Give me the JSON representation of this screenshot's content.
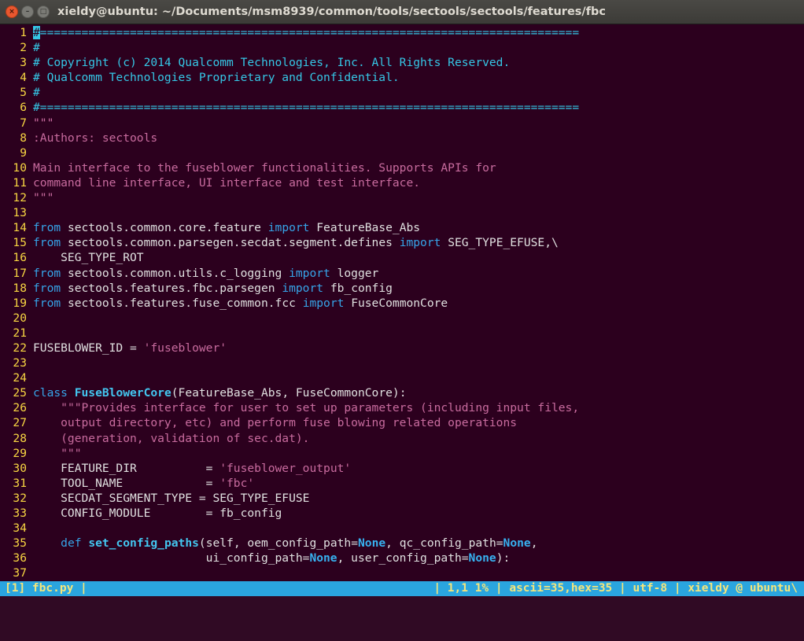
{
  "window": {
    "title": "xieldy@ubuntu: ~/Documents/msm8939/common/tools/sectools/sectools/features/fbc",
    "buttons": {
      "close": "×",
      "minimize": "–",
      "maximize": "□"
    }
  },
  "editor": {
    "lines": [
      {
        "n": "1",
        "segs": [
          {
            "t": "#",
            "c": "cur-block"
          },
          {
            "t": "==============================================================================",
            "c": "cm"
          }
        ]
      },
      {
        "n": "2",
        "segs": [
          {
            "t": "#",
            "c": "cm"
          }
        ]
      },
      {
        "n": "3",
        "segs": [
          {
            "t": "# Copyright (c) 2014 Qualcomm Technologies, Inc. All Rights Reserved.",
            "c": "cm"
          }
        ]
      },
      {
        "n": "4",
        "segs": [
          {
            "t": "# Qualcomm Technologies Proprietary and Confidential.",
            "c": "cm"
          }
        ]
      },
      {
        "n": "5",
        "segs": [
          {
            "t": "#",
            "c": "cm"
          }
        ]
      },
      {
        "n": "6",
        "segs": [
          {
            "t": "#==============================================================================",
            "c": "cm"
          }
        ]
      },
      {
        "n": "7",
        "segs": [
          {
            "t": "\"\"\"",
            "c": "str"
          }
        ]
      },
      {
        "n": "8",
        "segs": [
          {
            "t": ":Authors: sectools",
            "c": "str"
          }
        ]
      },
      {
        "n": "9",
        "segs": []
      },
      {
        "n": "10",
        "segs": [
          {
            "t": "Main interface to the fuseblower functionalities. Supports APIs for",
            "c": "str"
          }
        ]
      },
      {
        "n": "11",
        "segs": [
          {
            "t": "command line interface, UI interface and test interface.",
            "c": "str"
          }
        ]
      },
      {
        "n": "12",
        "segs": [
          {
            "t": "\"\"\"",
            "c": "str"
          }
        ]
      },
      {
        "n": "13",
        "segs": []
      },
      {
        "n": "14",
        "segs": [
          {
            "t": "from",
            "c": "kw"
          },
          {
            "t": " sectools.common.core.feature ",
            "c": ""
          },
          {
            "t": "import",
            "c": "kw"
          },
          {
            "t": " FeatureBase_Abs",
            "c": ""
          }
        ]
      },
      {
        "n": "15",
        "segs": [
          {
            "t": "from",
            "c": "kw"
          },
          {
            "t": " sectools.common.parsegen.secdat.segment.defines ",
            "c": ""
          },
          {
            "t": "import",
            "c": "kw"
          },
          {
            "t": " SEG_TYPE_EFUSE,\\",
            "c": ""
          }
        ]
      },
      {
        "n": "16",
        "segs": [
          {
            "t": "    SEG_TYPE_ROT",
            "c": ""
          }
        ]
      },
      {
        "n": "17",
        "segs": [
          {
            "t": "from",
            "c": "kw"
          },
          {
            "t": " sectools.common.utils.c_logging ",
            "c": ""
          },
          {
            "t": "import",
            "c": "kw"
          },
          {
            "t": " logger",
            "c": ""
          }
        ]
      },
      {
        "n": "18",
        "segs": [
          {
            "t": "from",
            "c": "kw"
          },
          {
            "t": " sectools.features.fbc.parsegen ",
            "c": ""
          },
          {
            "t": "import",
            "c": "kw"
          },
          {
            "t": " fb_config",
            "c": ""
          }
        ]
      },
      {
        "n": "19",
        "segs": [
          {
            "t": "from",
            "c": "kw"
          },
          {
            "t": " sectools.features.fuse_common.fcc ",
            "c": ""
          },
          {
            "t": "import",
            "c": "kw"
          },
          {
            "t": " FuseCommonCore",
            "c": ""
          }
        ]
      },
      {
        "n": "20",
        "segs": []
      },
      {
        "n": "21",
        "segs": []
      },
      {
        "n": "22",
        "segs": [
          {
            "t": "FUSEBLOWER_ID = ",
            "c": ""
          },
          {
            "t": "'fuseblower'",
            "c": "str"
          }
        ]
      },
      {
        "n": "23",
        "segs": []
      },
      {
        "n": "24",
        "segs": []
      },
      {
        "n": "25",
        "segs": [
          {
            "t": "class",
            "c": "kw"
          },
          {
            "t": " ",
            "c": ""
          },
          {
            "t": "FuseBlowerCore",
            "c": "cls"
          },
          {
            "t": "(FeatureBase_Abs, FuseCommonCore):",
            "c": ""
          }
        ]
      },
      {
        "n": "26",
        "segs": [
          {
            "t": "    ",
            "c": ""
          },
          {
            "t": "\"\"\"Provides interface for user to set up parameters (including input files,",
            "c": "str"
          }
        ]
      },
      {
        "n": "27",
        "segs": [
          {
            "t": "    output directory, etc) and perform fuse blowing related operations",
            "c": "str"
          }
        ]
      },
      {
        "n": "28",
        "segs": [
          {
            "t": "    (generation, validation of sec.dat).",
            "c": "str"
          }
        ]
      },
      {
        "n": "29",
        "segs": [
          {
            "t": "    \"\"\"",
            "c": "str"
          }
        ]
      },
      {
        "n": "30",
        "segs": [
          {
            "t": "    FEATURE_DIR          = ",
            "c": ""
          },
          {
            "t": "'fuseblower_output'",
            "c": "str"
          }
        ]
      },
      {
        "n": "31",
        "segs": [
          {
            "t": "    TOOL_NAME            = ",
            "c": ""
          },
          {
            "t": "'fbc'",
            "c": "str"
          }
        ]
      },
      {
        "n": "32",
        "segs": [
          {
            "t": "    SECDAT_SEGMENT_TYPE = SEG_TYPE_EFUSE",
            "c": ""
          }
        ]
      },
      {
        "n": "33",
        "segs": [
          {
            "t": "    CONFIG_MODULE        = fb_config",
            "c": ""
          }
        ]
      },
      {
        "n": "34",
        "segs": []
      },
      {
        "n": "35",
        "segs": [
          {
            "t": "    ",
            "c": ""
          },
          {
            "t": "def",
            "c": "kw"
          },
          {
            "t": " ",
            "c": ""
          },
          {
            "t": "set_config_paths",
            "c": "fn"
          },
          {
            "t": "(self, oem_config_path=",
            "c": ""
          },
          {
            "t": "None",
            "c": "cn"
          },
          {
            "t": ", qc_config_path=",
            "c": ""
          },
          {
            "t": "None",
            "c": "cn"
          },
          {
            "t": ",",
            "c": ""
          }
        ]
      },
      {
        "n": "36",
        "segs": [
          {
            "t": "                         ui_config_path=",
            "c": ""
          },
          {
            "t": "None",
            "c": "cn"
          },
          {
            "t": ", user_config_path=",
            "c": ""
          },
          {
            "t": "None",
            "c": "cn"
          },
          {
            "t": "):",
            "c": ""
          }
        ]
      },
      {
        "n": "37",
        "segs": []
      }
    ]
  },
  "statusbar": {
    "left": "[1] fbc.py |",
    "right": "| 1,1 1% | ascii=35,hex=35 | utf-8 | xieldy @ ubuntu\\"
  },
  "colors": {
    "background": "#2c001e",
    "line_numbers": "#f8d642",
    "comment": "#35c7e6",
    "string": "#c86b9e",
    "keyword": "#36a4e8",
    "statusbar_bg": "#2aa5df",
    "statusbar_fg": "#f5e57c"
  }
}
